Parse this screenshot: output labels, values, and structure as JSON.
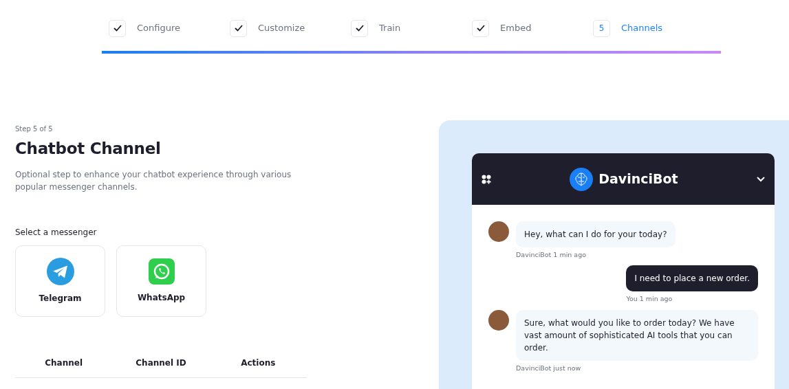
{
  "steps": [
    {
      "label": "Configure",
      "done": true,
      "selected": false
    },
    {
      "label": "Customize",
      "done": true,
      "selected": false
    },
    {
      "label": "Train",
      "done": true,
      "selected": false
    },
    {
      "label": "Embed",
      "done": true,
      "selected": false
    },
    {
      "label": "Channels",
      "number": "5",
      "done": false,
      "selected": true
    }
  ],
  "progress": {
    "level": 1
  },
  "step_caption": "Step 5 of 5",
  "title": "Chatbot Channel",
  "description": "Optional step to enhance your chatbot experience through various popular messenger channels.",
  "messenger_label": "Select a messenger",
  "messengers": [
    {
      "kind": "telegram",
      "label": "Telegram",
      "selected": false
    },
    {
      "kind": "whatsapp",
      "label": "WhatsApp",
      "selected": false
    }
  ],
  "table": {
    "columns": [
      "Channel",
      "Channel ID",
      "Actions"
    ]
  },
  "chat": {
    "title": "DavinciBot",
    "messages": [
      {
        "kind": "bot",
        "text": "Hey, what can I do for your today?",
        "meta": "DavinciBot 1 min ago"
      },
      {
        "kind": "user",
        "text": "I need to place a new order.",
        "meta": "You 1 min ago"
      },
      {
        "kind": "bot",
        "text": "Sure, what would you like to order today? We have vast amount of sophisticated AI tools that you can order.",
        "meta": "DavinciBot just now"
      }
    ]
  }
}
